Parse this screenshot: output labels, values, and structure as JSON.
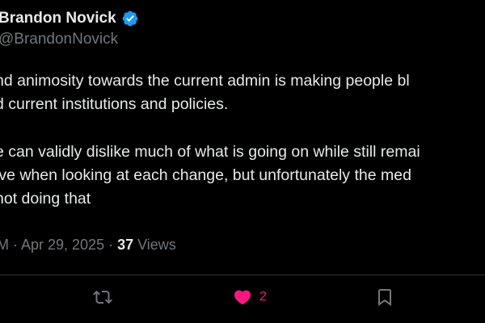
{
  "author": {
    "display_name": "Brandon Novick",
    "handle": "@BrandonNovick",
    "verified_icon": "verified-badge-icon",
    "verified_color": "#1d9bf0"
  },
  "tweet": {
    "paragraphs": [
      [
        "nd animosity towards the current admin is making people bl",
        "d current institutions and policies."
      ],
      [
        "e can validly dislike much of what is going on while still remai",
        "ive when looking at each change, but unfortunately the med",
        " not doing that"
      ]
    ]
  },
  "meta": {
    "time_and_date": "M · Apr 29, 2025 · ",
    "views_count": "37",
    "views_label": " Views"
  },
  "actions": {
    "retweet_icon": "retweet-icon",
    "like_icon": "heart-filled-icon",
    "like_count": "2",
    "like_color": "#f91880",
    "bookmark_icon": "bookmark-icon"
  },
  "colors": {
    "background": "#000000",
    "text": "#e7e9ea",
    "secondary_text": "#71767b",
    "divider": "#2f3336"
  }
}
